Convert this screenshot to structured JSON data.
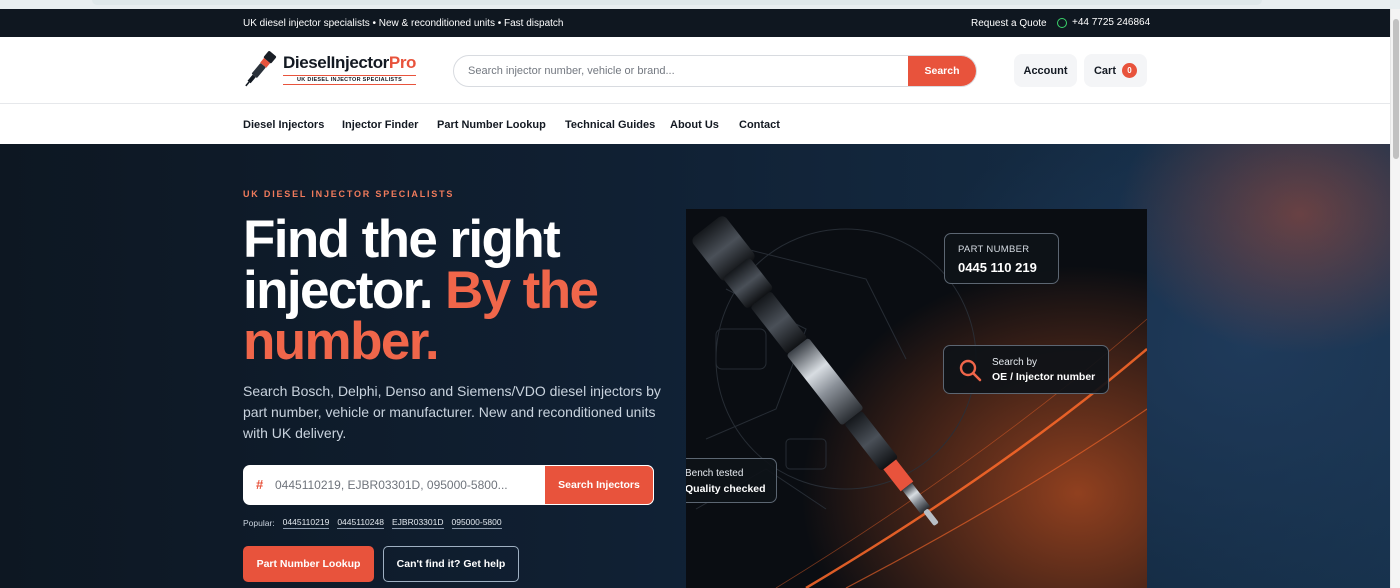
{
  "topbar": {
    "promo": "UK diesel injector specialists • New & reconditioned units • Fast dispatch",
    "quote": "Request a Quote",
    "phone": "+44 7725 246864",
    "phone_icon": "whatsapp-icon"
  },
  "header": {
    "logo_name_main": "DieselInjector",
    "logo_name_accent": "Pro",
    "logo_tagline": "UK DIESEL INJECTOR SPECIALISTS",
    "search_placeholder": "Search injector number, vehicle or brand...",
    "search_button": "Search",
    "account": "Account",
    "cart": "Cart",
    "cart_count": "0"
  },
  "nav": {
    "items": [
      "Diesel Injectors",
      "Injector Finder",
      "Part Number Lookup",
      "Technical Guides",
      "About Us",
      "Contact"
    ]
  },
  "hero": {
    "eyebrow": "UK DIESEL INJECTOR SPECIALISTS",
    "headline_white": "Find the right injector.",
    "headline_accent": "By the number.",
    "sub": "Search Bosch, Delphi, Denso and Siemens/VDO diesel injectors by part number, vehicle or manufacturer. New and reconditioned units with UK delivery.",
    "search_prefix": "#",
    "search_placeholder": "0445110219, EJBR03301D, 095000-5800...",
    "search_button": "Search Injectors",
    "popular_label": "Popular:",
    "popular": [
      "0445110219",
      "0445110248",
      "EJBR03301D",
      "095000-5800"
    ],
    "cta_primary": "Part Number Lookup",
    "cta_secondary": "Can't find it? Get help"
  },
  "media": {
    "part_label": "PART NUMBER",
    "part_value": "0445 110 219",
    "search_line1": "Search by",
    "search_line2": "OE / Injector number",
    "bench_line1": "Bench tested",
    "bench_line2": "Quality checked"
  },
  "colors": {
    "accent": "#e8533c",
    "topbar_bg": "#0f1720",
    "hero_bg": "#102033"
  }
}
